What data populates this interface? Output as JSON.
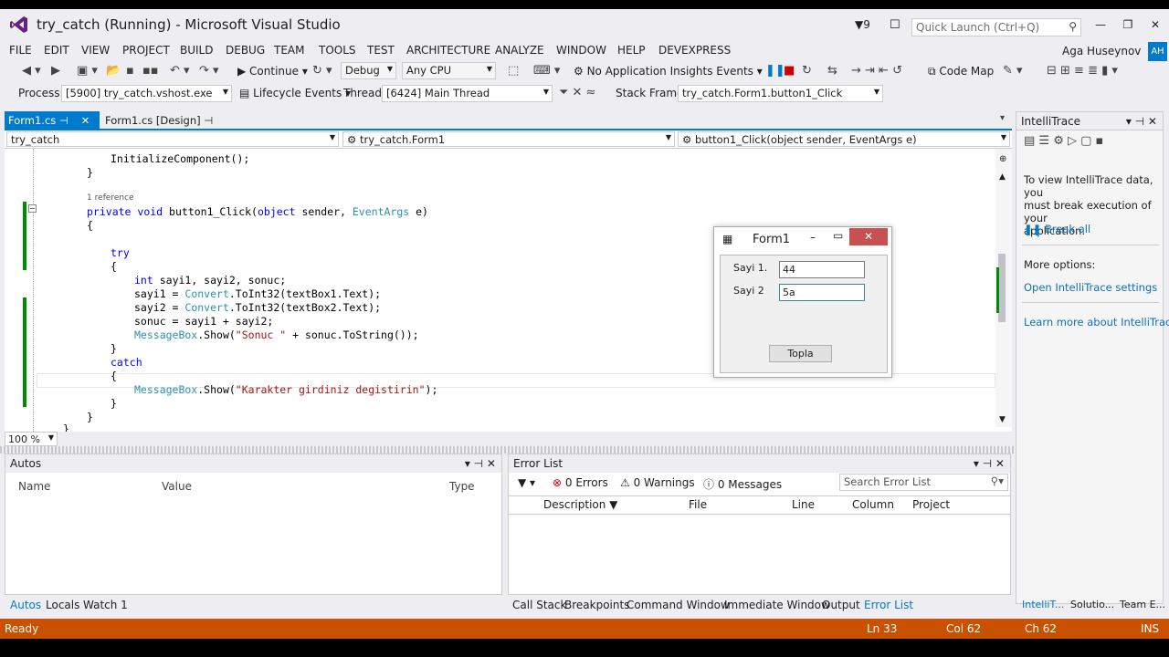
{
  "window": {
    "title": "try_catch (Running) - Microsoft Visual Studio",
    "notifications": "9",
    "quick_launch_placeholder": "Quick Launch (Ctrl+Q)",
    "user": "Aga Huseynov",
    "avatar": "AH"
  },
  "menu": [
    "FILE",
    "EDIT",
    "VIEW",
    "PROJECT",
    "BUILD",
    "DEBUG",
    "TEAM",
    "TOOLS",
    "TEST",
    "ARCHITECTURE",
    "ANALYZE",
    "WINDOW",
    "HELP",
    "DEVEXPRESS"
  ],
  "toolbar": {
    "continue_label": "Continue",
    "config": "Debug",
    "platform": "Any CPU",
    "insights": "No Application Insights Events",
    "code_map": "Code Map"
  },
  "debug_location": {
    "process_label": "Process:",
    "process": "[5900] try_catch.vshost.exe",
    "lifecycle": "Lifecycle Events",
    "thread_label": "Thread:",
    "thread": "[6424] Main Thread",
    "stack_label": "Stack Frame:",
    "stack": "try_catch.Form1.button1_Click"
  },
  "tabs": {
    "active": "Form1.cs",
    "second": "Form1.cs [Design]"
  },
  "navigation": {
    "project": "try_catch",
    "class": "try_catch.Form1",
    "member": "button1_Click(object sender, EventArgs e)"
  },
  "code": {
    "line1": "InitializeComponent();",
    "line2": "}",
    "reference": "1 reference",
    "sig_private": "private",
    "sig_void": "void",
    "sig_name": "button1_Click(",
    "sig_object": "object",
    "sig_sender": "sender,",
    "sig_eventargs": "EventArgs",
    "sig_e": "e)",
    "open1": "{",
    "try": "try",
    "open2": "{",
    "decl_int": "int",
    "decl_rest": "sayi1, sayi2, sonuc;",
    "a1_left": "sayi1 =",
    "convert": "Convert",
    "a1_right": ".ToInt32(textBox1.Text);",
    "a2_left": "sayi2 =",
    "a2_right": ".ToInt32(textBox2.Text);",
    "sum": "sonuc = sayi1 + sayi2;",
    "messagebox": "MessageBox",
    "show_open": ".Show(",
    "str_sonuc": "\"Sonuc \"",
    "show_rest": " + sonuc.ToString());",
    "close2": "}",
    "catch": "catch",
    "open3": "{",
    "str_karakter": "\"Karakter girdiniz degistirin\"",
    "show_close": ");",
    "close3": "}",
    "close4": "}",
    "close5": "}"
  },
  "zoom": "100 %",
  "form1": {
    "title": "Form1",
    "label1": "Sayi 1.",
    "label2": "Sayi 2",
    "value1": "44",
    "value2": "5a",
    "button": "Topla"
  },
  "autos": {
    "title": "Autos",
    "columns": [
      "Name",
      "Value",
      "Type"
    ],
    "tabs": [
      "Autos",
      "Locals",
      "Watch 1"
    ]
  },
  "error_list": {
    "title": "Error List",
    "errors": "0 Errors",
    "warnings": "0 Warnings",
    "messages": "0 Messages",
    "search_placeholder": "Search Error List",
    "columns": [
      "Description",
      "File",
      "Line",
      "Column",
      "Project"
    ],
    "tabs": [
      "Call Stack",
      "Breakpoints",
      "Command Window",
      "Immediate Window",
      "Output",
      "Error List"
    ]
  },
  "intellitrace": {
    "title": "IntelliTrace",
    "message": [
      "To view IntelliTrace data, you",
      "must break execution of your",
      "application."
    ],
    "break_all": "Break all",
    "more_options": "More options:",
    "open_settings": "Open IntelliTrace settings",
    "learn_more": "Learn more about IntelliTrace",
    "tabs": [
      "IntelliT...",
      "Solutio...",
      "Team E..."
    ]
  },
  "status": {
    "state": "Ready",
    "ln": "Ln 33",
    "col": "Col 62",
    "ch": "Ch 62",
    "mode": "INS"
  },
  "colors": {
    "accent": "#007acc",
    "statusbar": "#ca5100",
    "keyword": "#0000ff",
    "type": "#2b91af",
    "string": "#a31515"
  }
}
